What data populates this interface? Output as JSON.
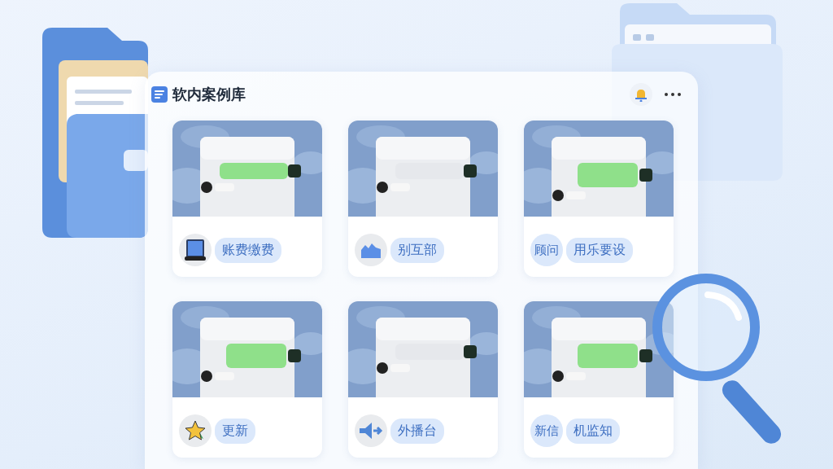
{
  "window": {
    "title": "软内案例库"
  },
  "cards": [
    {
      "badge": {
        "kind": "icon"
      },
      "tags": [
        "账费缴费"
      ]
    },
    {
      "badge": {
        "kind": "icon"
      },
      "tags": [
        "别互部"
      ]
    },
    {
      "badge": {
        "kind": "text",
        "text": "顾问"
      },
      "tags": [
        "用乐要设"
      ]
    },
    {
      "badge": {
        "kind": "icon"
      },
      "tags": [
        "更新"
      ]
    },
    {
      "badge": {
        "kind": "icon"
      },
      "tags": [
        "外播台"
      ]
    },
    {
      "badge": {
        "kind": "text",
        "text": "新信"
      },
      "tags": [
        "机监知"
      ]
    }
  ]
}
